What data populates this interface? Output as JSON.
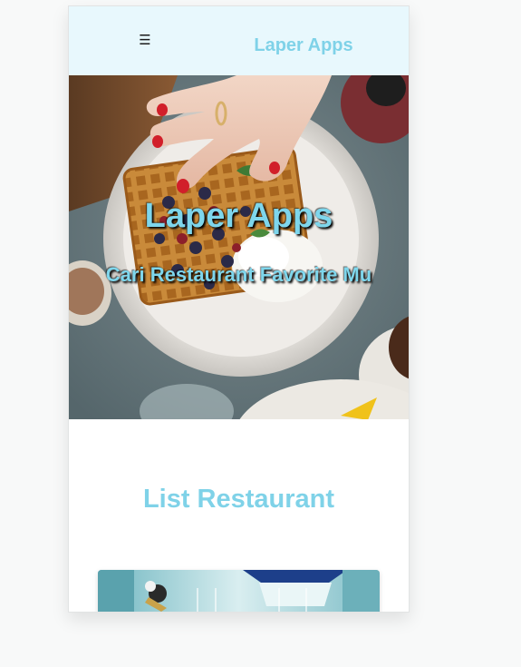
{
  "app_bar": {
    "menu_icon": "☰",
    "title": "Laper Apps"
  },
  "hero": {
    "title": "Laper Apps",
    "subtitle": "Cari Restaurant Favorite Mu"
  },
  "main": {
    "section_title": "List Restaurant"
  }
}
